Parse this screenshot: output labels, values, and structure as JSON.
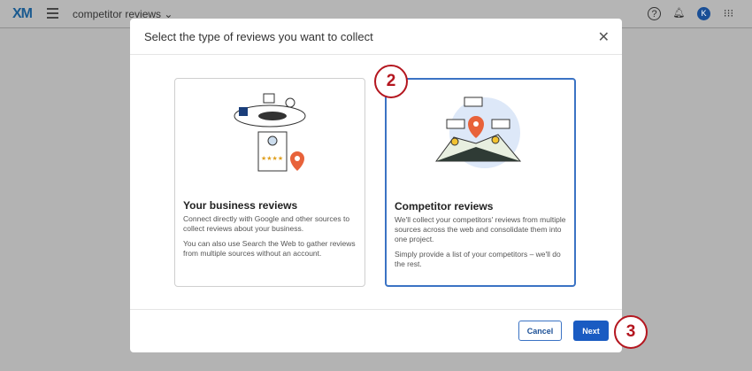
{
  "topbar": {
    "logo": "XM",
    "project": "competitor reviews ⌄",
    "avatar": "K"
  },
  "modal": {
    "title": "Select the type of reviews you want to collect",
    "cards": [
      {
        "title": "Your business reviews",
        "p1": "Connect directly with Google and other sources to collect reviews about your business.",
        "p2": "You can also use Search the Web to gather reviews from multiple sources without an account."
      },
      {
        "title": "Competitor reviews",
        "p1": "We'll collect your competitors' reviews from multiple sources across the web and consolidate them into one project.",
        "p2": "Simply provide a list of your competitors – we'll do the rest."
      }
    ],
    "cancel": "Cancel",
    "next": "Next"
  },
  "steps": [
    "2",
    "3"
  ]
}
